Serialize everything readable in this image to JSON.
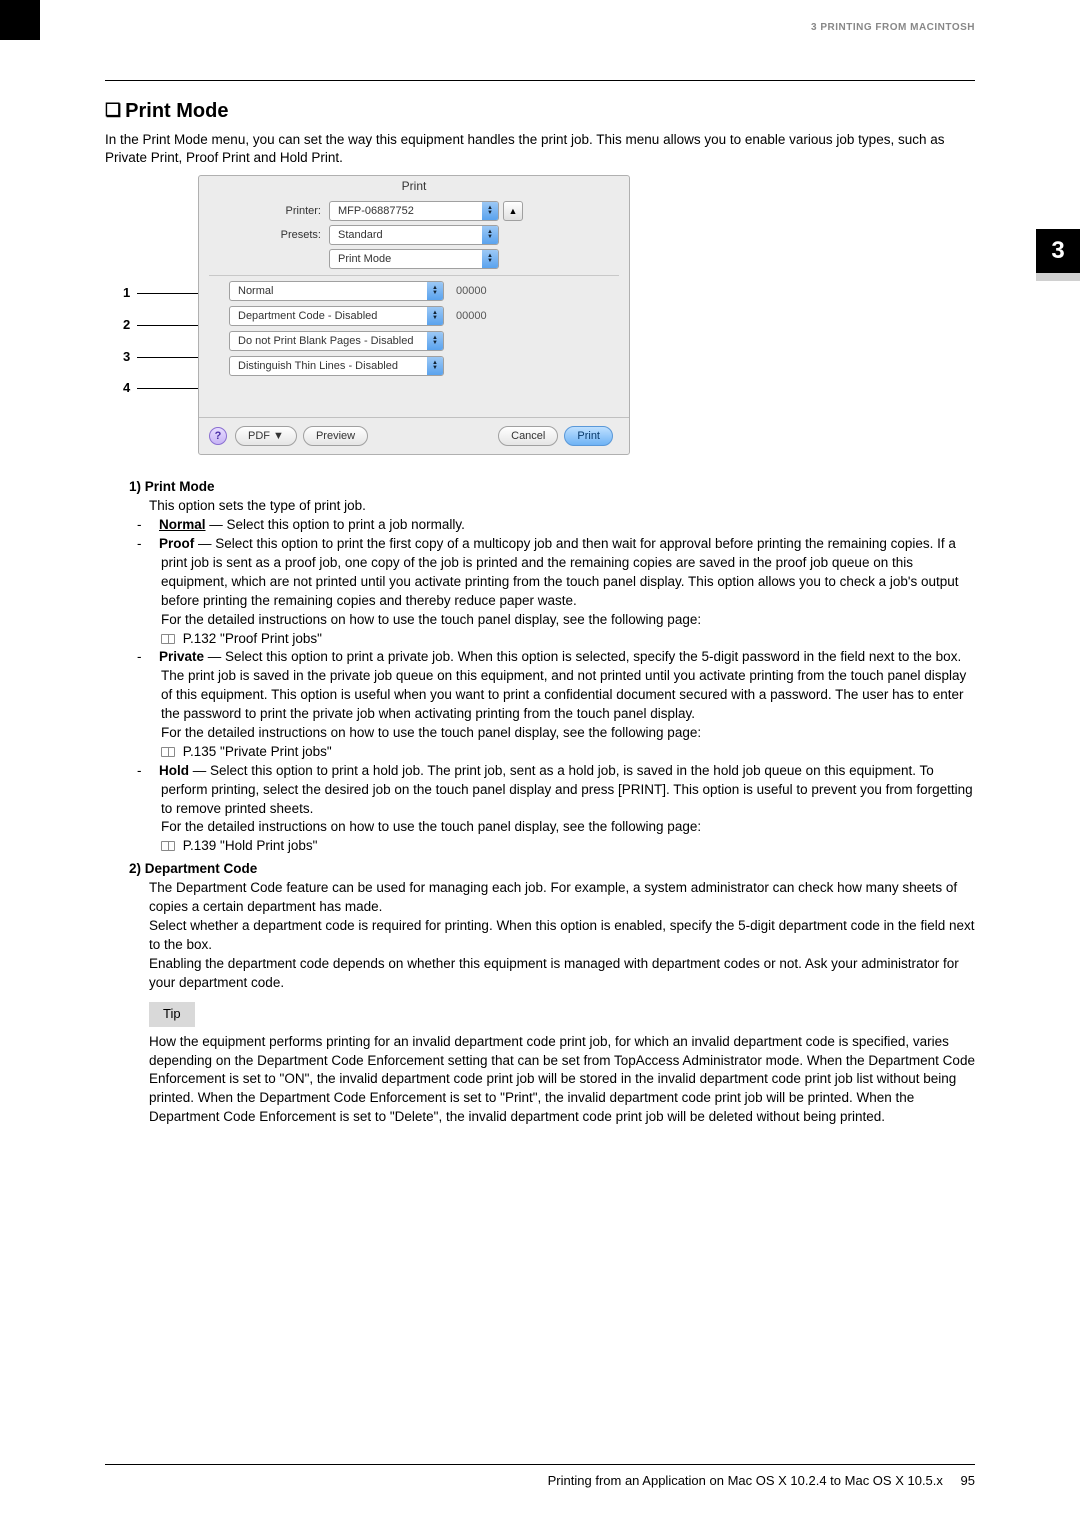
{
  "header": {
    "breadcrumb": "3 PRINTING FROM MACINTOSH"
  },
  "side_tab": "3",
  "section": {
    "title": "Print Mode",
    "intro": "In the Print Mode menu, you can set the way this equipment handles the print job. This menu allows you to enable various job types, such as Private Print, Proof Print and Hold Print."
  },
  "dialog": {
    "title": "Print",
    "printer_label": "Printer:",
    "printer_value": "MFP-06887752",
    "presets_label": "Presets:",
    "presets_value": "Standard",
    "panel_value": "Print Mode",
    "options": [
      {
        "value": "Normal",
        "code": "00000"
      },
      {
        "value": "Department Code - Disabled",
        "code": "00000"
      },
      {
        "value": "Do not Print Blank Pages - Disabled",
        "code": ""
      },
      {
        "value": "Distinguish Thin Lines - Disabled",
        "code": ""
      }
    ],
    "pdf_btn": "PDF ▼",
    "preview_btn": "Preview",
    "cancel_btn": "Cancel",
    "print_btn": "Print"
  },
  "callouts": [
    "1",
    "2",
    "3",
    "4"
  ],
  "items": {
    "i1": {
      "num": "1)",
      "title": "Print Mode",
      "lead": "This option sets the type of print job.",
      "normal_label": "Normal",
      "normal_text": " — Select this option to print a job normally.",
      "proof_label": "Proof",
      "proof_text": " — Select this option to print the first copy of a multicopy job and then wait for approval before printing the remaining copies. If a print job is sent as a proof job, one copy of the job is printed and the remaining copies are saved in the proof job queue on this equipment, which are not printed until you activate printing from the touch panel display. This option allows you to check a job's output before printing the remaining copies and thereby reduce paper waste.",
      "proof_detail": "For the detailed instructions on how to use the touch panel display, see the following page:",
      "proof_ref": " P.132 \"Proof Print jobs\"",
      "private_label": "Private",
      "private_text": " — Select this option to print a private job. When this option is selected, specify the 5-digit password in the field next to the box. The print job is saved in the private job queue on this equipment, and not printed until you activate printing from the touch panel display of this equipment. This option is useful when you want to print a confidential document secured with a password. The user has to enter the password to print the private job when activating printing from the touch panel display.",
      "private_detail": "For the detailed instructions on how to use the touch panel display, see the following page:",
      "private_ref": " P.135 \"Private Print jobs\"",
      "hold_label": "Hold",
      "hold_text": " — Select this option to print a hold job. The print job, sent as a hold job, is saved in the hold job queue on this equipment. To perform printing, select the desired job on the touch panel display and press [PRINT]. This option is useful to prevent you from forgetting to remove printed sheets.",
      "hold_detail": "For the detailed instructions on how to use the touch panel display, see the following page:",
      "hold_ref": " P.139 \"Hold Print jobs\""
    },
    "i2": {
      "num": "2)",
      "title": "Department Code",
      "p1": "The Department Code feature can be used for managing each job. For example, a system administrator can check how many sheets of copies a certain department has made.",
      "p2": "Select whether a department code is required for printing. When this option is enabled, specify the 5-digit department code in the field next to the box.",
      "p3": "Enabling the department code depends on whether this equipment is managed with department codes or not. Ask your administrator for your department code.",
      "tip_label": "Tip",
      "tip_body": "How the equipment performs printing for an invalid department code print job, for which an invalid department code is specified, varies depending on the Department Code Enforcement setting that can be set from TopAccess Administrator mode. When the Department Code Enforcement is set to \"ON\", the invalid department code print job will be stored in the invalid department code print job list without being printed. When the Department Code Enforcement is set to \"Print\", the invalid department code print job will be printed. When the Department Code Enforcement is set to \"Delete\", the invalid department code print job will be deleted without being printed."
    }
  },
  "footer": {
    "text": "Printing from an Application on Mac OS X 10.2.4 to Mac OS X 10.5.x",
    "page": "95"
  }
}
